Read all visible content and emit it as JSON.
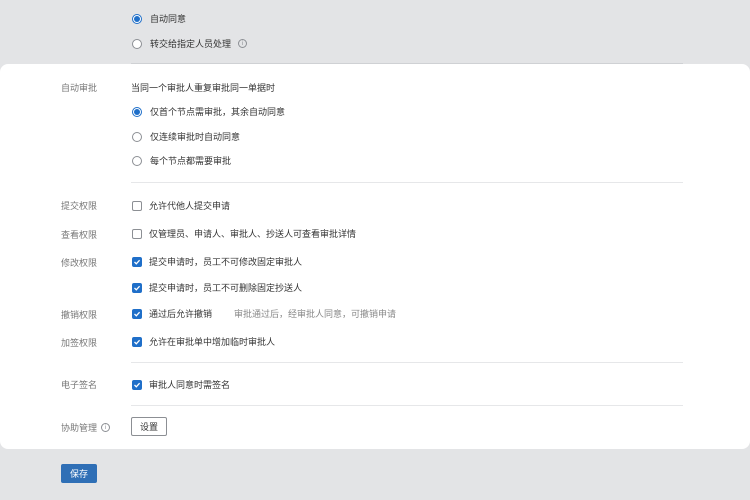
{
  "top": {
    "options": [
      {
        "label": "自动同意",
        "checked": true
      },
      {
        "label": "转交给指定人员处理",
        "checked": false
      }
    ],
    "info_icon": "i"
  },
  "auto_approve": {
    "label": "自动审批",
    "title": "当同一个审批人重复审批同一单据时",
    "options": [
      {
        "label": "仅首个节点需审批，其余自动同意",
        "checked": true
      },
      {
        "label": "仅连续审批时自动同意",
        "checked": false
      },
      {
        "label": "每个节点都需要审批",
        "checked": false
      }
    ]
  },
  "submit_perm": {
    "label": "提交权限",
    "option": "允许代他人提交申请",
    "checked": false
  },
  "view_perm": {
    "label": "查看权限",
    "option": "仅管理员、申请人、审批人、抄送人可查看审批详情",
    "checked": false
  },
  "modify_perm": {
    "label": "修改权限",
    "options": [
      {
        "label": "提交申请时，员工不可修改固定审批人",
        "checked": true
      },
      {
        "label": "提交申请时，员工不可删除固定抄送人",
        "checked": true
      }
    ]
  },
  "revoke_perm": {
    "label": "撤销权限",
    "option": "通过后允许撤销",
    "hint": "审批通过后，经审批人同意，可撤销申请",
    "checked": true
  },
  "add_sign_perm": {
    "label": "加签权限",
    "option": "允许在审批单中增加临时审批人",
    "checked": true
  },
  "e_sign": {
    "label": "电子签名",
    "option": "审批人同意时需签名",
    "checked": true
  },
  "assist": {
    "label": "协助管理",
    "info_icon": "i",
    "button": "设置"
  },
  "footer": {
    "save": "保存"
  },
  "colors": {
    "accent": "#1f6fc9",
    "save_button": "#2f6fb6",
    "page_bg": "#e3e4e6"
  }
}
